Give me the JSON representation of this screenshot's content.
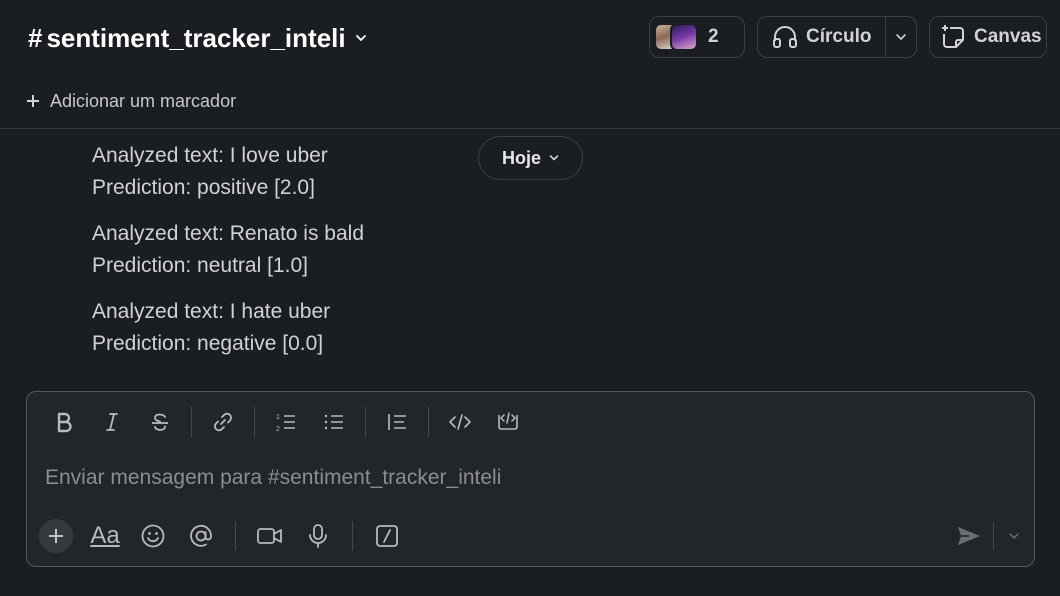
{
  "header": {
    "hash": "#",
    "channel_name": "sentiment_tracker_inteli",
    "member_count": "2",
    "huddle_label": "Círculo",
    "canvas_label": "Canvas"
  },
  "bookmark": {
    "label": "Adicionar um marcador"
  },
  "date_divider": {
    "label": "Hoje"
  },
  "messages": [
    {
      "line1": "Analyzed text: I love uber",
      "line2": "Prediction: positive [2.0]"
    },
    {
      "line1": "Analyzed text: Renato is bald",
      "line2": "Prediction: neutral [1.0]"
    },
    {
      "line1": "Analyzed text: I hate uber",
      "line2": "Prediction: negative [0.0]"
    }
  ],
  "composer": {
    "placeholder": "Enviar mensagem para #sentiment_tracker_inteli",
    "format_label": "Aa",
    "toolbar_icons": [
      "bold-icon",
      "italic-icon",
      "strikethrough-icon",
      "link-icon",
      "ordered-list-icon",
      "bulleted-list-icon",
      "blockquote-icon",
      "code-icon",
      "code-block-icon"
    ],
    "bottom_icons": [
      "plus-icon",
      "format-icon",
      "emoji-icon",
      "mention-icon",
      "video-icon",
      "microphone-icon",
      "shortcuts-icon",
      "send-icon"
    ]
  },
  "colors": {
    "background": "#1a1d21",
    "composer_background": "#222529",
    "text": "#d1d2d3",
    "border": "#3c3f44"
  }
}
